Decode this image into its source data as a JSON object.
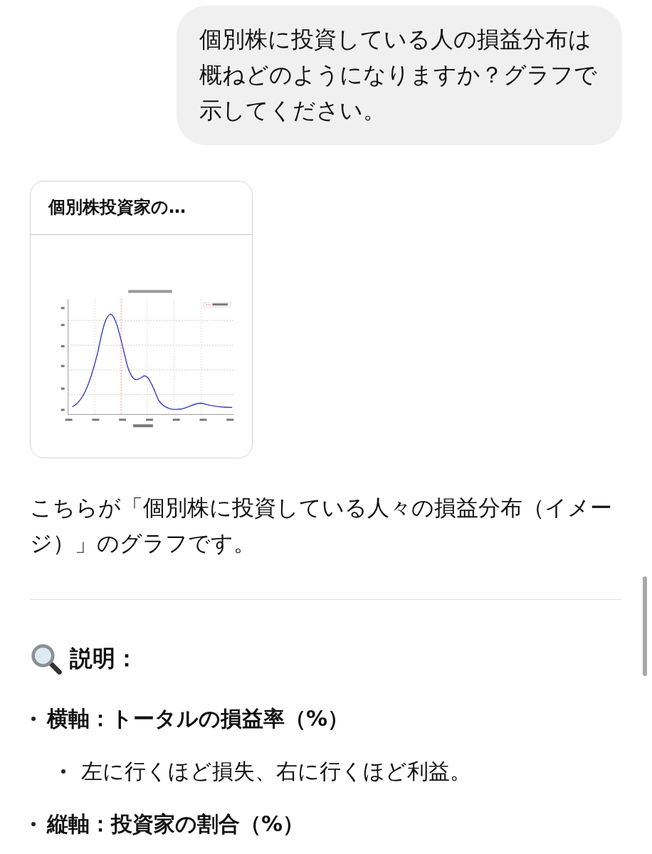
{
  "user_message": {
    "text": "個別株に投資している人の損益分布は概ねどのようになりますか？グラフで示してください。"
  },
  "attachment": {
    "title": "個別株投資家の…",
    "kind": "picture"
  },
  "reply": {
    "text": "こちらが「個別株に投資している人々の損益分布（イメージ）」のグラフです。",
    "heading": "説明：",
    "bullets": [
      {
        "text": "横軸：トータルの損益率（%）",
        "children": [
          {
            "text": "左に行くほど損失、右に行くほど利益。"
          }
        ]
      },
      {
        "text": "縦軸：投資家の割合（%）"
      }
    ]
  }
}
